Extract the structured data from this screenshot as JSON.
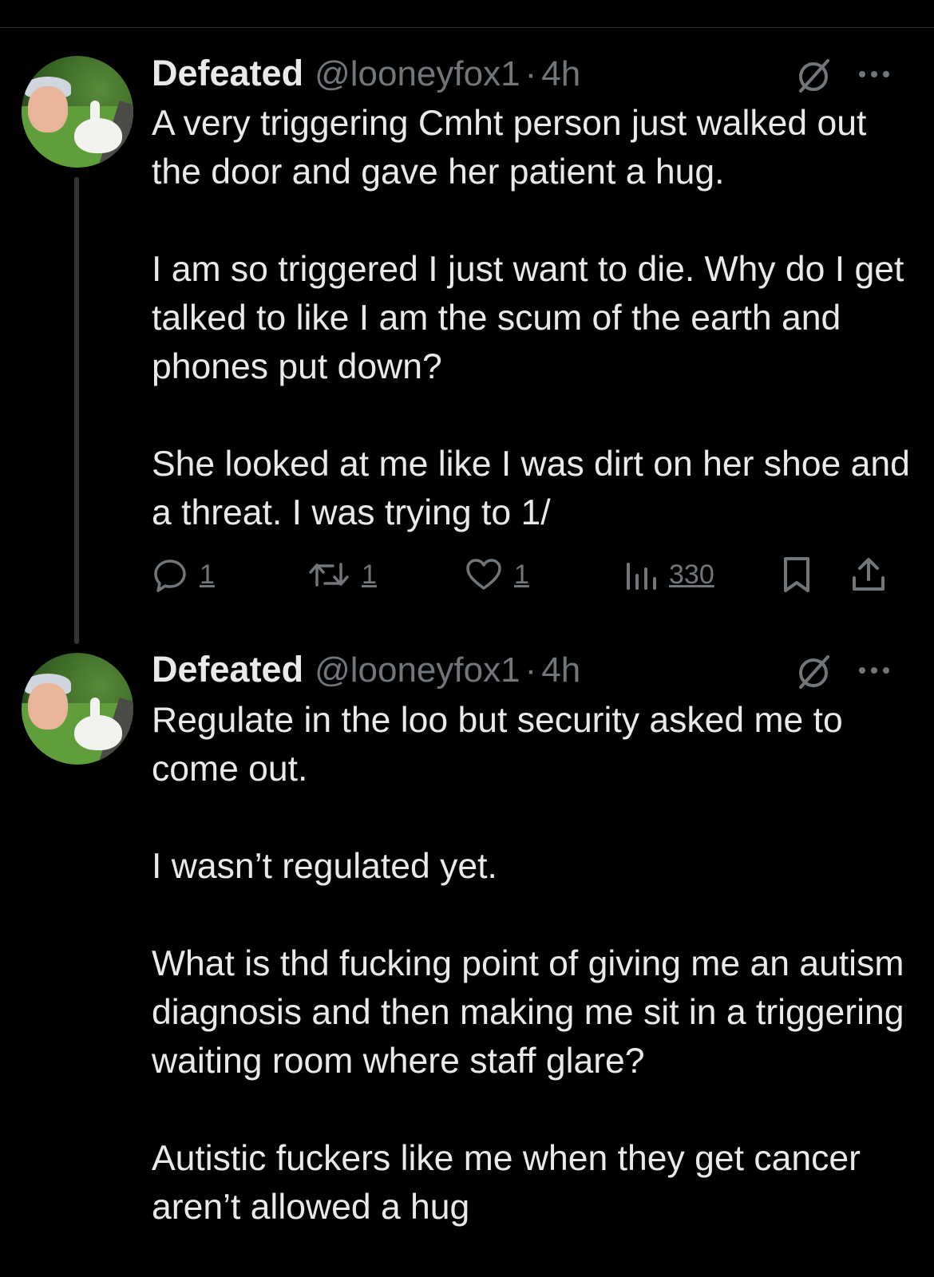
{
  "tweets": [
    {
      "display_name": "Defeated",
      "handle": "@looneyfox1",
      "separator": "·",
      "time": "4h",
      "text": "A very triggering Cmht person just walked out the door and gave her patient a hug.\n\nI am so triggered I just want to die.  Why do I get talked to like I am the scum of the earth and phones put down?\n\nShe looked at me like I was dirt on her shoe and a threat.  I was trying to 1/",
      "actions": {
        "reply_count": "1",
        "retweet_count": "1",
        "like_count": "1",
        "view_count": "330"
      },
      "icons": [
        "avatar",
        "slash-circle-icon",
        "more-icon",
        "reply-icon",
        "retweet-icon",
        "like-icon",
        "views-icon",
        "bookmark-icon",
        "share-icon"
      ]
    },
    {
      "display_name": "Defeated",
      "handle": "@looneyfox1",
      "separator": "·",
      "time": "4h",
      "text": "Regulate in the loo but security asked me to come out.\n\nI wasn’t regulated yet.\n\nWhat is thd fucking point of giving me an autism diagnosis and then making me sit in a triggering waiting room where staff glare?\n\nAutistic fuckers like me when they get cancer aren’t allowed a hug",
      "icons": [
        "avatar",
        "slash-circle-icon",
        "more-icon"
      ]
    }
  ],
  "colors": {
    "background": "#000000",
    "text": "#e7e9ea",
    "secondary": "#71767b",
    "divider": "#2f3336"
  }
}
